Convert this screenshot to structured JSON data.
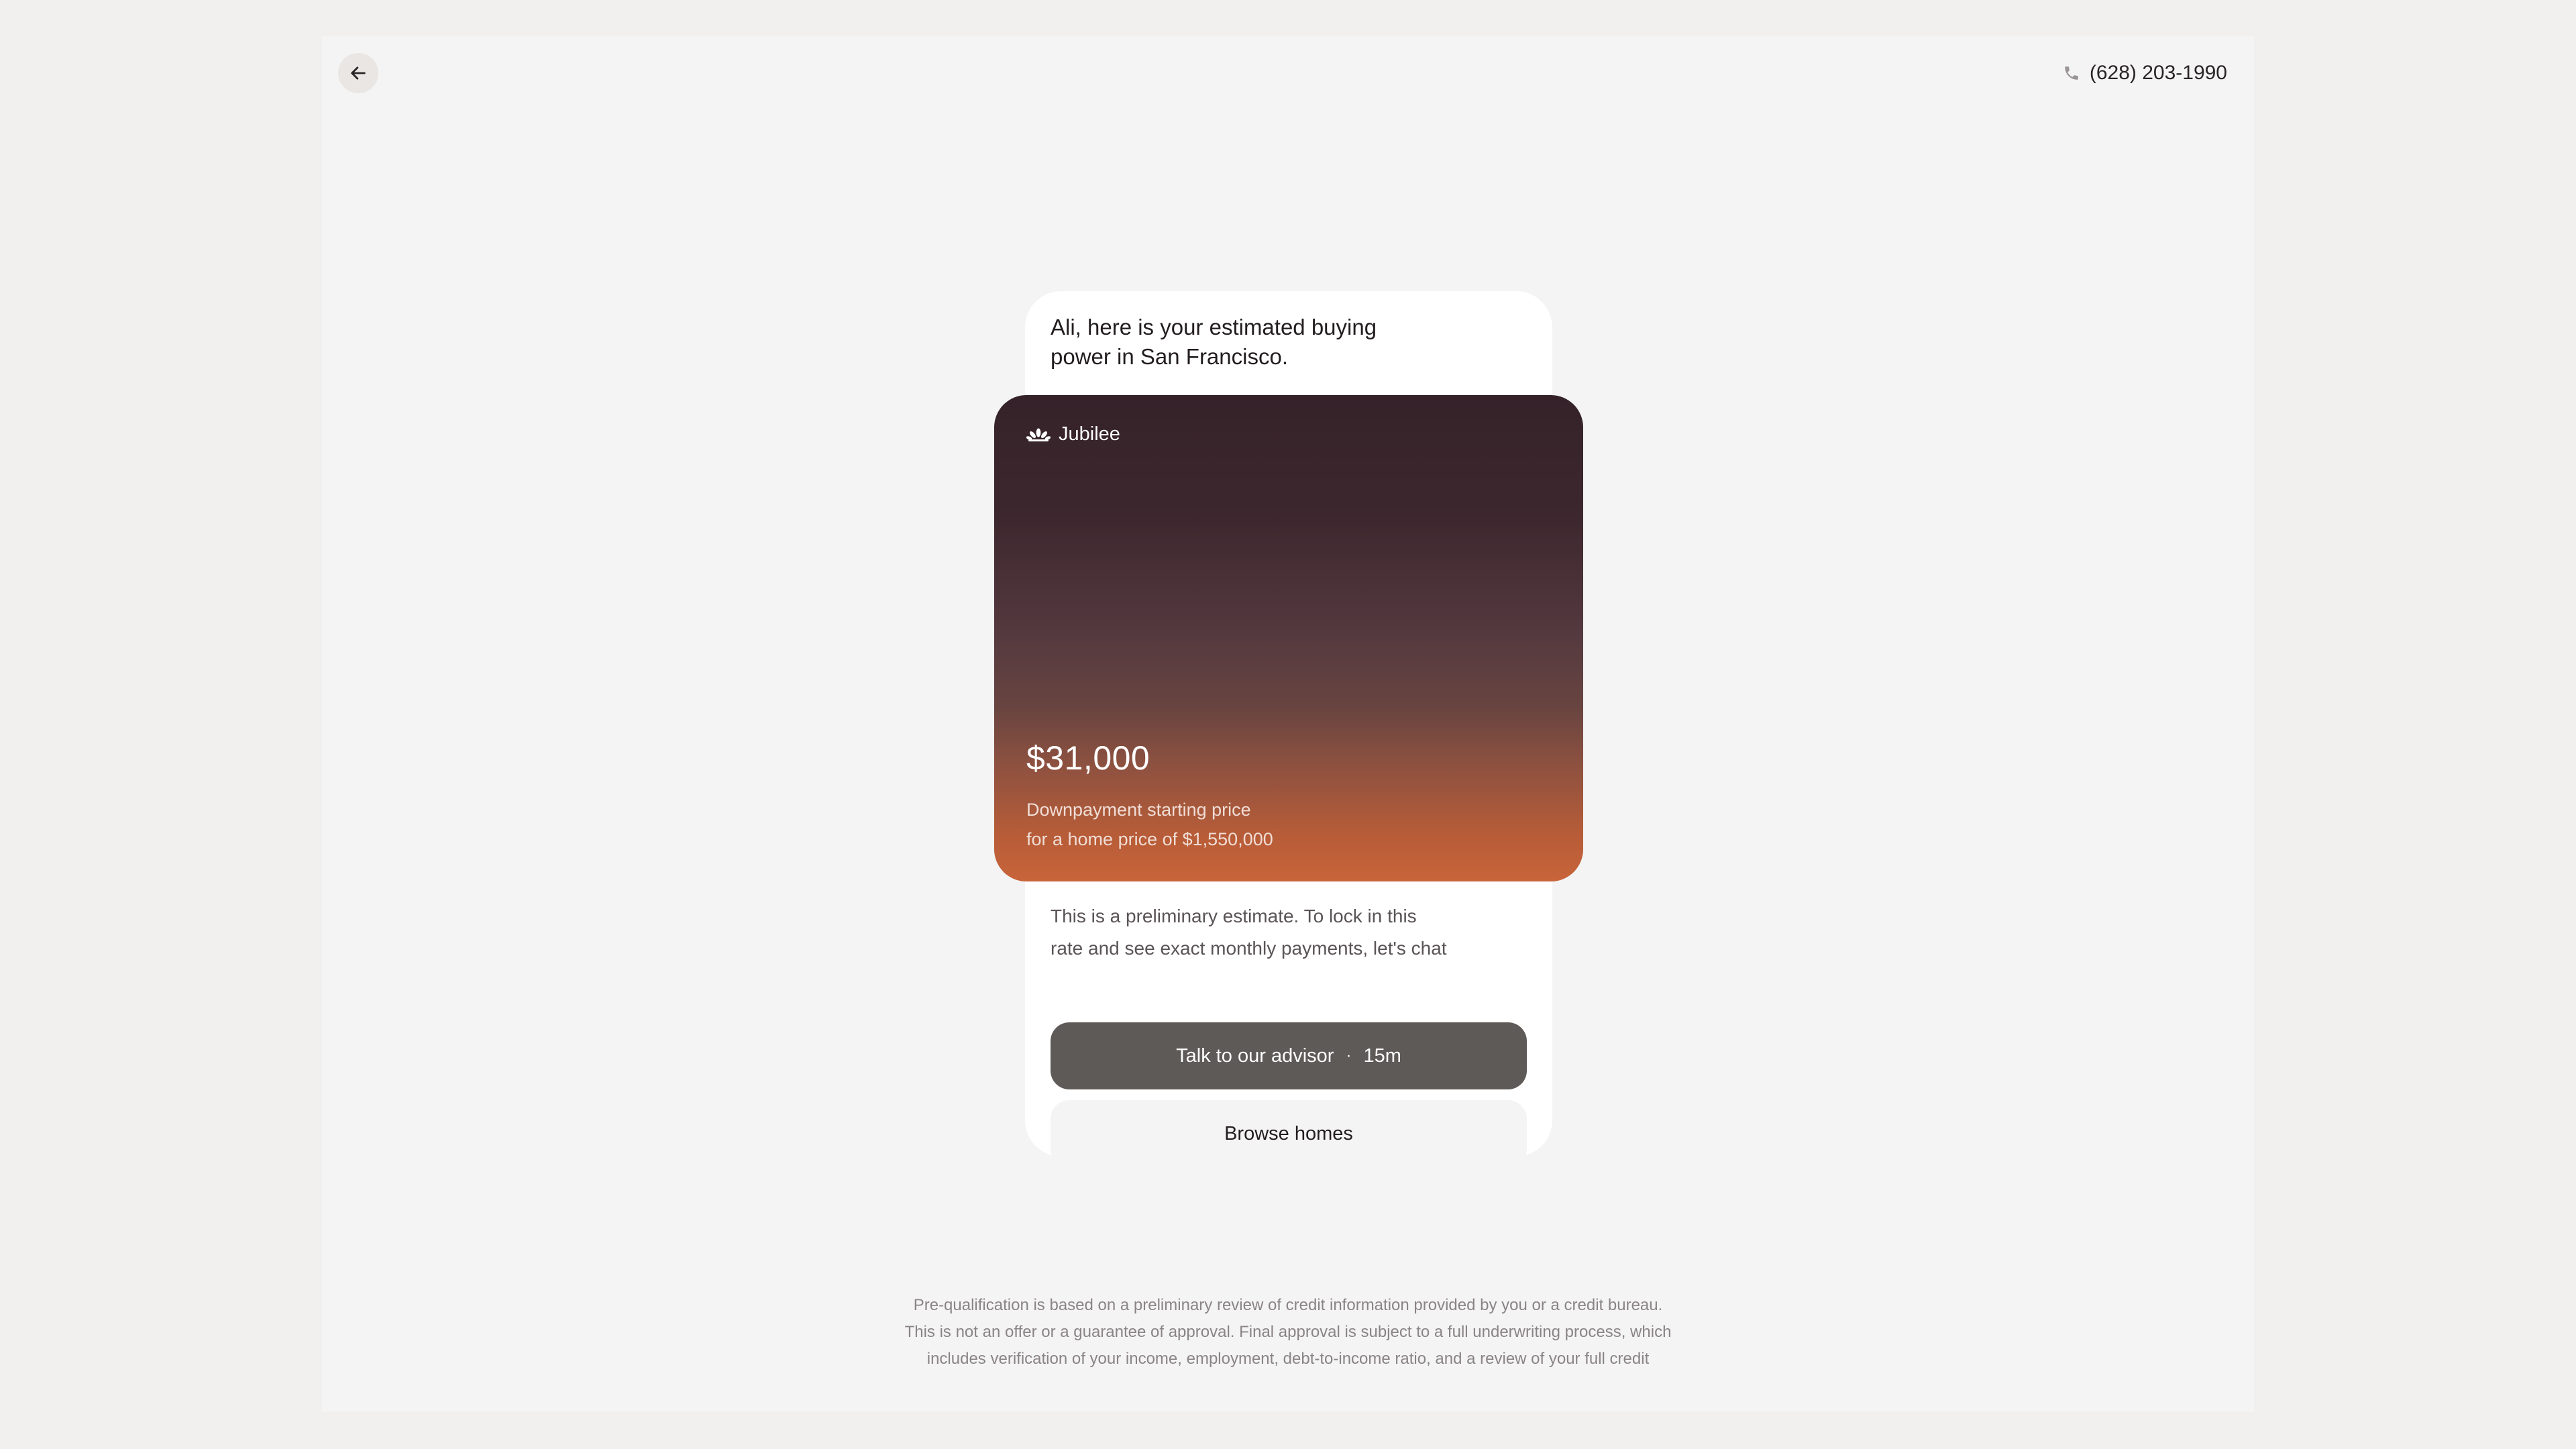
{
  "header": {
    "back_icon": "arrow-left-icon",
    "phone_icon": "phone-icon",
    "phone_number": "(628) 203-1990"
  },
  "main": {
    "headline_line1": "Ali, here is your estimated buying",
    "headline_line2": "power in San Francisco.",
    "card": {
      "brand_icon": "jubilee-logo-icon",
      "brand_name": "Jubilee",
      "amount": "$31,000",
      "caption_line1": "Downpayment starting price",
      "caption_line2": "for a home price of $1,550,000"
    },
    "note_line1": "This is a preliminary estimate. To lock in this",
    "note_line2": "rate and see exact monthly payments, let's chat",
    "advisor_button": {
      "label": "Talk to our advisor",
      "separator": "·",
      "duration": "15m"
    },
    "browse_button_label": "Browse homes"
  },
  "footer": {
    "disclaimer_line1": "Pre-qualification is based on a preliminary review of credit information provided by you or a credit bureau.",
    "disclaimer_line2": "This is not an offer or a guarantee of approval. Final approval is subject to a full underwriting process, which",
    "disclaimer_line3": "includes verification of your income, employment, debt-to-income ratio, and a review of your full credit"
  },
  "colors": {
    "background": "#f1f0ee",
    "panel": "#ffffff",
    "card_top": "#352229",
    "card_bottom": "#c8643a",
    "advisor_button": "#5e5a58"
  }
}
